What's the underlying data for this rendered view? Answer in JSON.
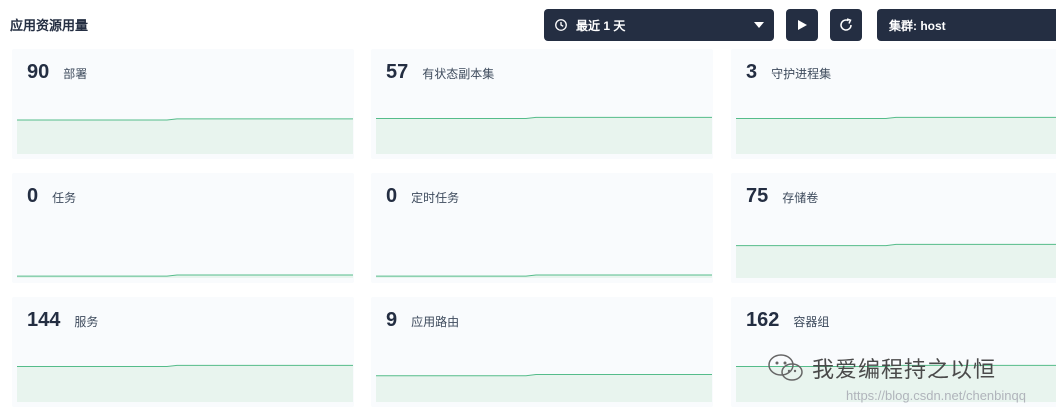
{
  "page": {
    "title": "应用资源用量"
  },
  "toolbar": {
    "time_range": "最近 1 天",
    "cluster": "集群: host"
  },
  "colors": {
    "dark": "#242e42",
    "chart_line": "#55bc8a",
    "chart_fill": "#e8f4ee",
    "card_bg": "#f9fbfd"
  },
  "cards": [
    {
      "value": "90",
      "label": "部署",
      "level": 0.65
    },
    {
      "value": "57",
      "label": "有状态副本集",
      "level": 0.68
    },
    {
      "value": "3",
      "label": "守护进程集",
      "level": 0.68
    },
    {
      "value": "0",
      "label": "任务",
      "level": 0.02
    },
    {
      "value": "0",
      "label": "定时任务",
      "level": 0.02
    },
    {
      "value": "75",
      "label": "存储卷",
      "level": 0.62
    },
    {
      "value": "144",
      "label": "服务",
      "level": 0.68
    },
    {
      "value": "9",
      "label": "应用路由",
      "level": 0.5
    },
    {
      "value": "162",
      "label": "容器组",
      "level": 0.68
    }
  ],
  "watermark": {
    "text": "我爱编程持之以恒",
    "url": "https://blog.csdn.net/chenbinqq"
  }
}
